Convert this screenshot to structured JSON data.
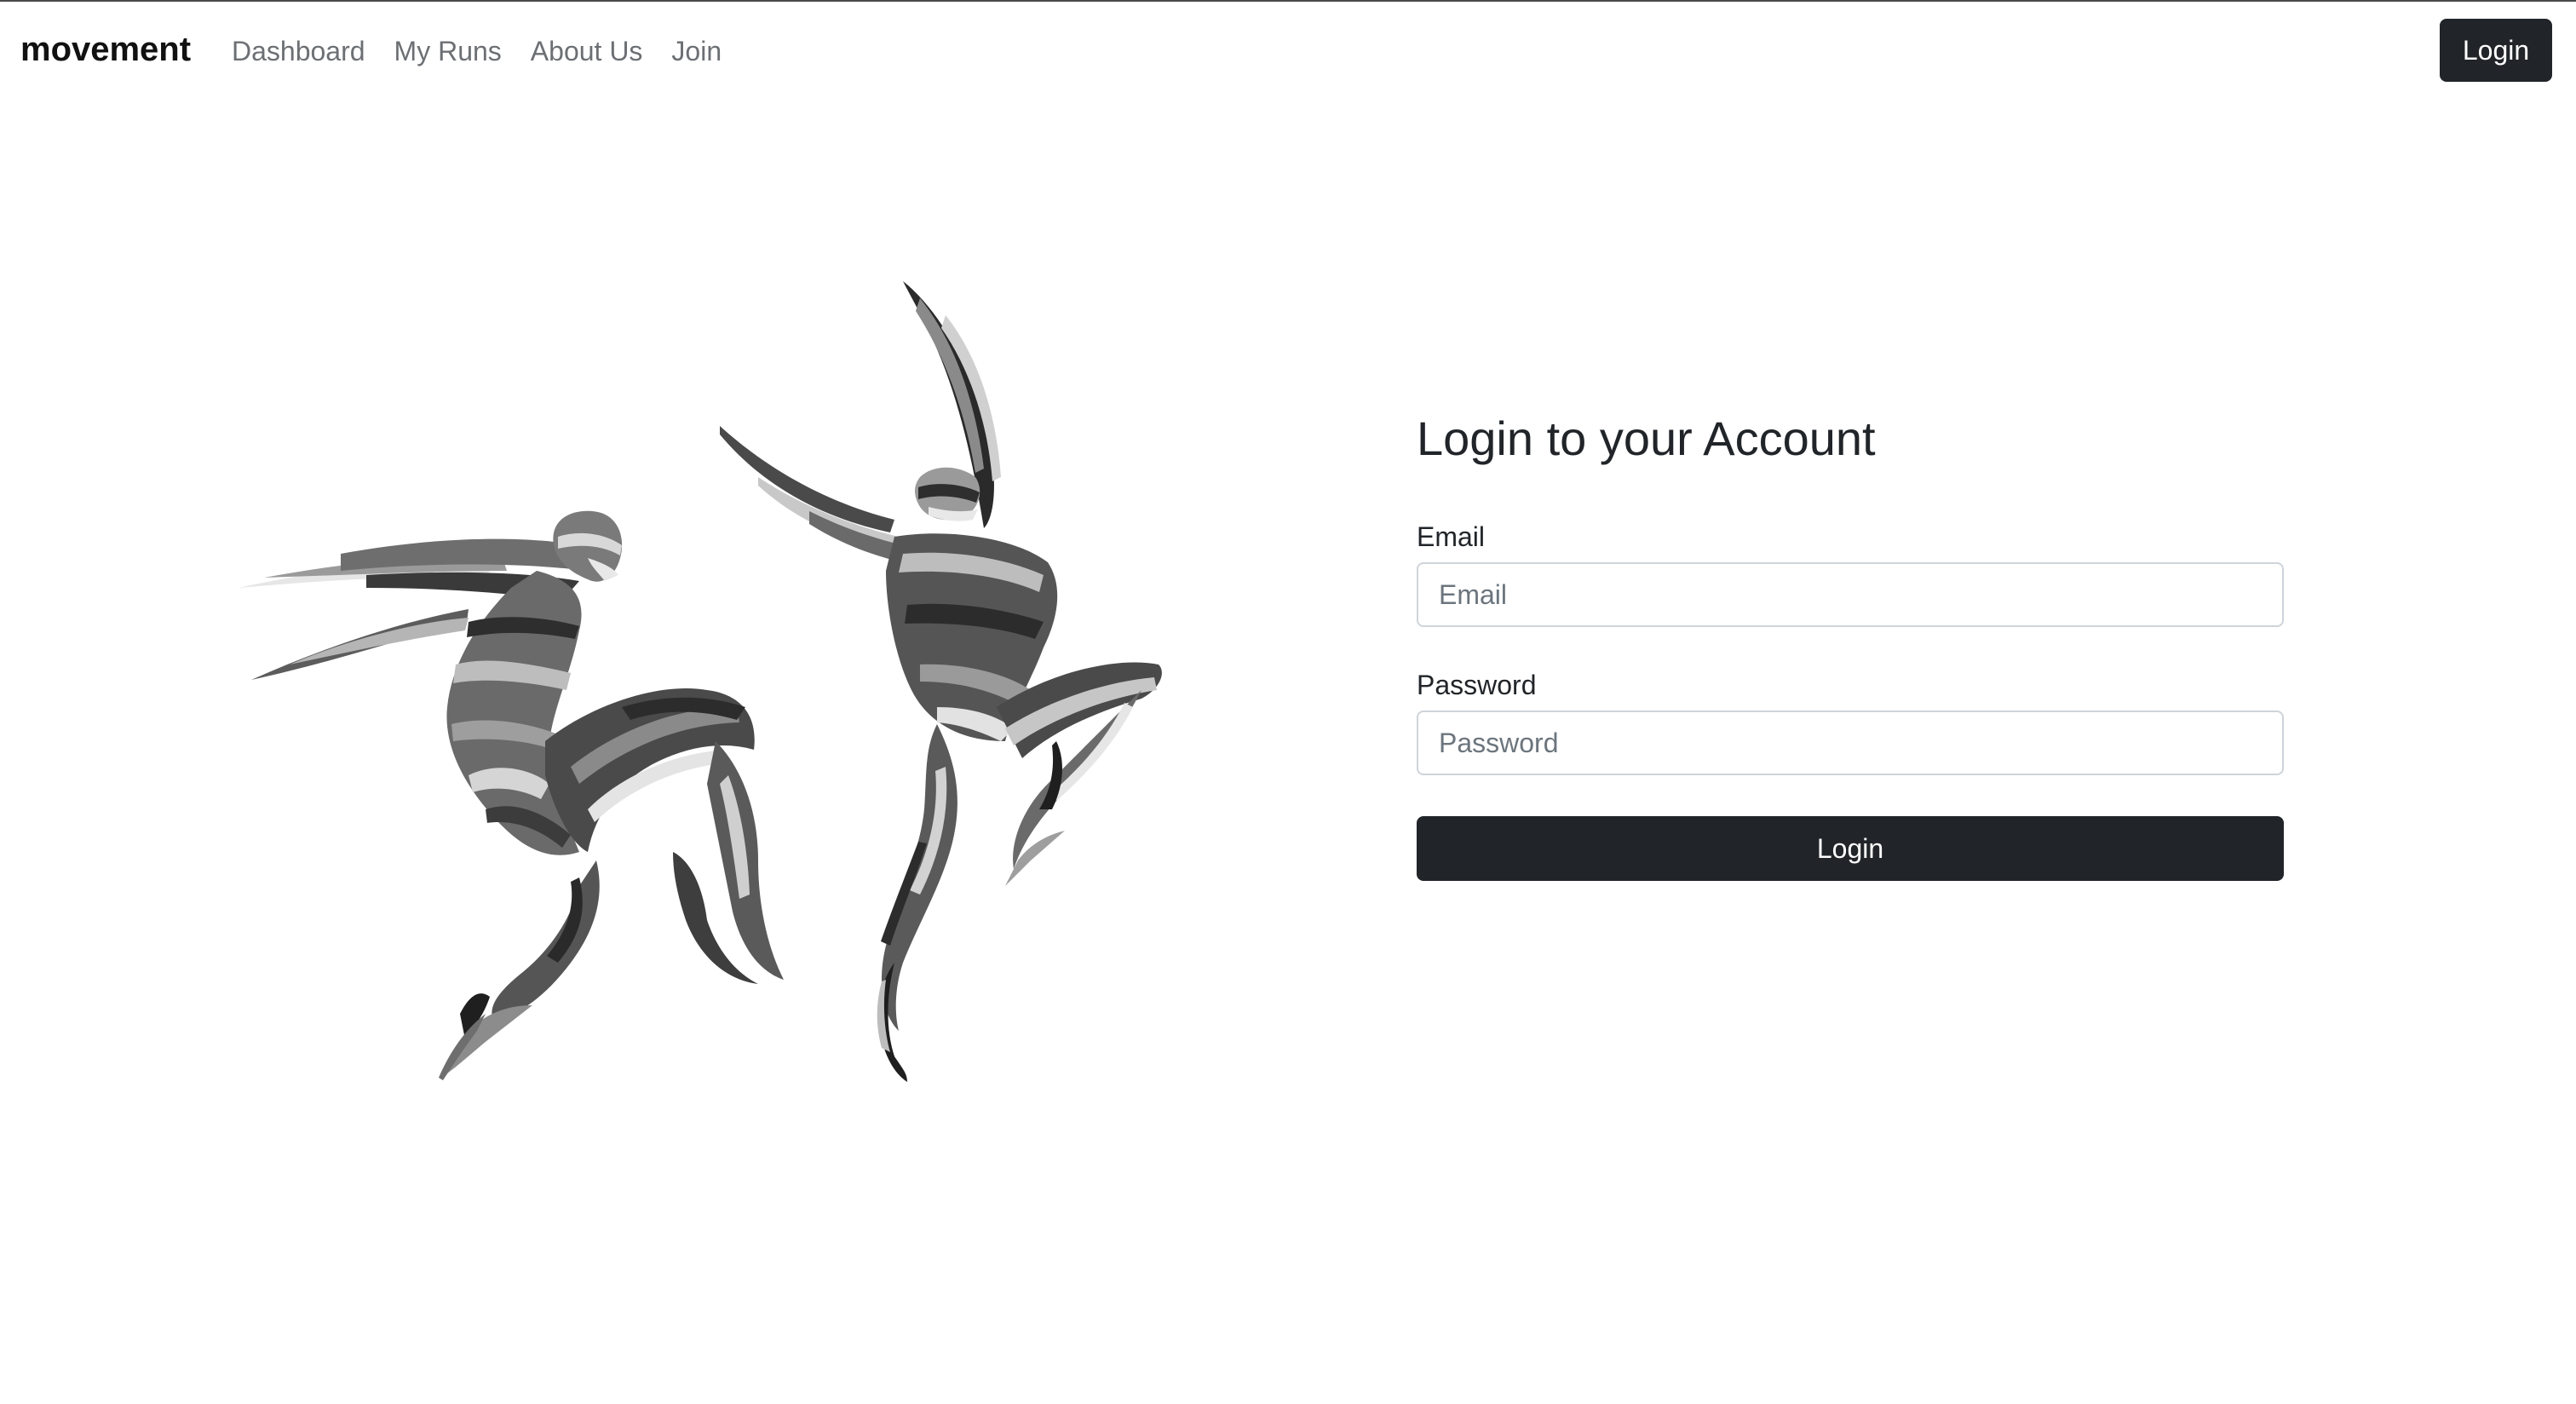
{
  "navbar": {
    "brand": "movement",
    "links": [
      {
        "label": "Dashboard"
      },
      {
        "label": "My Runs"
      },
      {
        "label": "About Us"
      },
      {
        "label": "Join"
      }
    ],
    "login_button": "Login"
  },
  "illustration": {
    "icon": "two-leaping-runners-illustration"
  },
  "login_form": {
    "title": "Login to your Account",
    "email_label": "Email",
    "email_placeholder": "Email",
    "email_value": "",
    "password_label": "Password",
    "password_placeholder": "Password",
    "password_value": "",
    "submit_label": "Login"
  },
  "colors": {
    "primary_dark": "#212529",
    "nav_link": "#6c6f73",
    "input_border": "#ced4da"
  }
}
